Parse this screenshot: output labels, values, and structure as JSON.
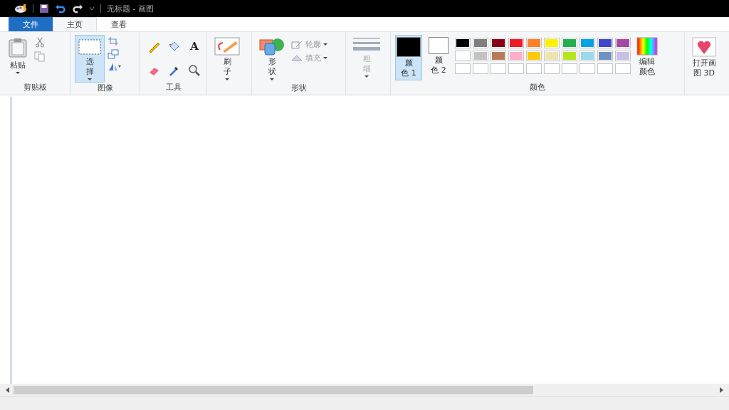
{
  "window": {
    "title": "无标题 - 画图"
  },
  "tabs": [
    {
      "label": "文件",
      "kind": "file",
      "selected": false
    },
    {
      "label": "主页",
      "kind": "tab",
      "selected": true
    },
    {
      "label": "查看",
      "kind": "tab",
      "selected": false
    }
  ],
  "ribbon": {
    "clipboard": {
      "paste": "粘贴",
      "group": "剪贴板"
    },
    "image": {
      "select_lines": [
        "选",
        "择"
      ],
      "selected": true,
      "group": "图像"
    },
    "tools": {
      "text_glyph": "A",
      "group": "工具"
    },
    "brush": {
      "label_lines": [
        "刷",
        "子"
      ]
    },
    "shapes": {
      "label_lines": [
        "形",
        "状"
      ],
      "outline": {
        "label": "轮廓",
        "disabled": true
      },
      "fill": {
        "label": "填充",
        "disabled": true
      },
      "group": "形状"
    },
    "size": {
      "label_lines": [
        "粗",
        "细"
      ],
      "disabled": true
    },
    "colors": {
      "color1": {
        "label_lines": [
          "颜",
          "色 1"
        ],
        "color": "#000000",
        "selected": true
      },
      "color2": {
        "label_lines": [
          "颜",
          "色 2"
        ],
        "color": "#ffffff",
        "selected": false
      },
      "palette": [
        {
          "kind": "swatch",
          "color": "#000000"
        },
        {
          "kind": "swatch",
          "color": "#7f7f7f"
        },
        {
          "kind": "swatch",
          "color": "#880015"
        },
        {
          "kind": "swatch",
          "color": "#ed1c24"
        },
        {
          "kind": "swatch",
          "color": "#ff7f27"
        },
        {
          "kind": "swatch",
          "color": "#fff200"
        },
        {
          "kind": "swatch",
          "color": "#22b14c"
        },
        {
          "kind": "swatch",
          "color": "#00a2e8"
        },
        {
          "kind": "swatch",
          "color": "#3f48cc"
        },
        {
          "kind": "swatch",
          "color": "#a349a4"
        },
        {
          "kind": "swatch",
          "color": "#ffffff"
        },
        {
          "kind": "swatch",
          "color": "#c3c3c3"
        },
        {
          "kind": "swatch",
          "color": "#b97a57"
        },
        {
          "kind": "swatch",
          "color": "#ffaec9"
        },
        {
          "kind": "swatch",
          "color": "#ffc90e"
        },
        {
          "kind": "swatch",
          "color": "#efe4b0"
        },
        {
          "kind": "swatch",
          "color": "#b5e61d"
        },
        {
          "kind": "swatch",
          "color": "#99d9ea"
        },
        {
          "kind": "swatch",
          "color": "#7092be"
        },
        {
          "kind": "swatch",
          "color": "#c8bfe7"
        },
        {
          "kind": "empty"
        },
        {
          "kind": "empty"
        },
        {
          "kind": "empty"
        },
        {
          "kind": "empty"
        },
        {
          "kind": "empty"
        },
        {
          "kind": "empty"
        },
        {
          "kind": "empty"
        },
        {
          "kind": "empty"
        },
        {
          "kind": "empty"
        },
        {
          "kind": "empty"
        }
      ],
      "edit_lines": [
        "编辑",
        "颜色"
      ],
      "group": "颜色"
    },
    "paint3d": {
      "label_lines": [
        "打开画",
        "图 3D"
      ]
    }
  }
}
